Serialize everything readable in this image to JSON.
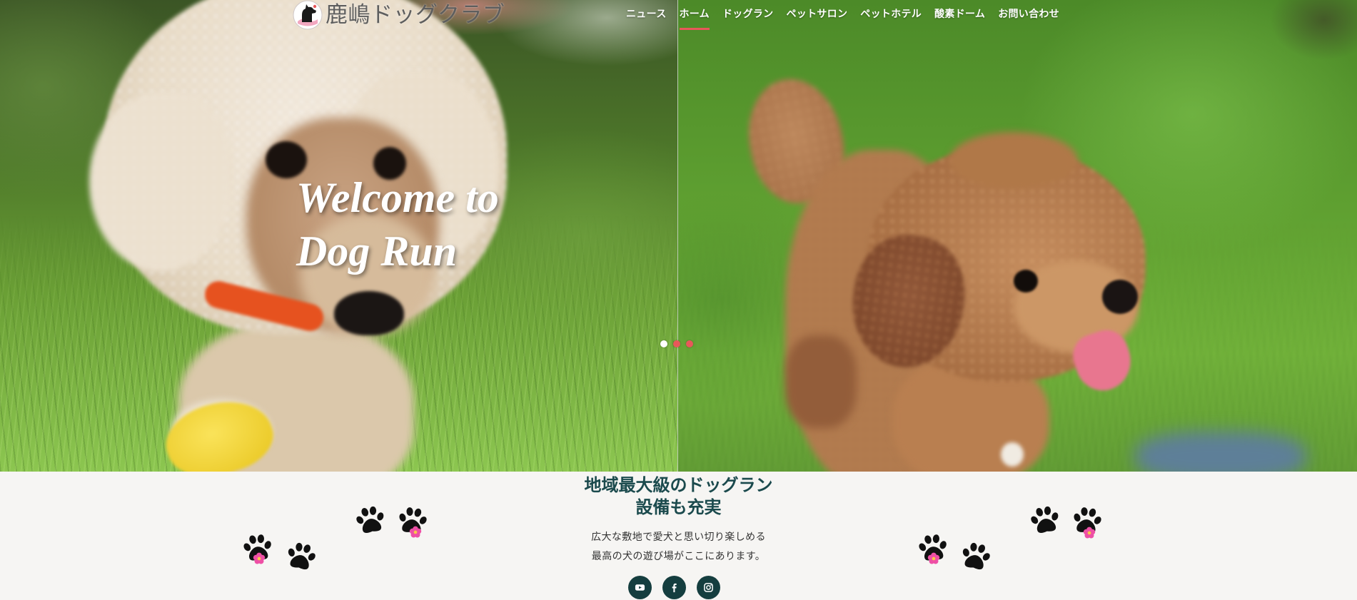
{
  "logo": {
    "text": "鹿嶋ドッグクラブ",
    "icon": "dog-logo-icon"
  },
  "nav": {
    "active_index": 1,
    "items": [
      {
        "label": "ニュース"
      },
      {
        "label": "ホーム"
      },
      {
        "label": "ドッグラン"
      },
      {
        "label": "ペットサロン"
      },
      {
        "label": "ペットホテル"
      },
      {
        "label": "酸素ドーム"
      },
      {
        "label": "お問い合わせ"
      }
    ]
  },
  "hero": {
    "title_line1": "Welcome to",
    "title_line2": "Dog Run",
    "slides": {
      "count": 3,
      "active_index": 0
    }
  },
  "intro": {
    "heading_line1": "地域最大級のドッグラン",
    "heading_line2": "設備も充実",
    "text_line1": "広大な敷地で愛犬と思い切り楽しめる",
    "text_line2": "最高の犬の遊び場がここにあります。"
  },
  "social": [
    {
      "icon": "youtube-icon"
    },
    {
      "icon": "facebook-icon"
    },
    {
      "icon": "instagram-icon"
    }
  ],
  "decor": {
    "paw_icon": "paw-print-icon",
    "flower_icon": "flower-icon"
  },
  "colors": {
    "accent": "#e8585a",
    "heading": "#1b4a4d",
    "social_bg": "#153e3f",
    "section_bg": "#f6f5f3",
    "nav_text": "#ffffff",
    "logo_text": "#5e5e5e"
  }
}
